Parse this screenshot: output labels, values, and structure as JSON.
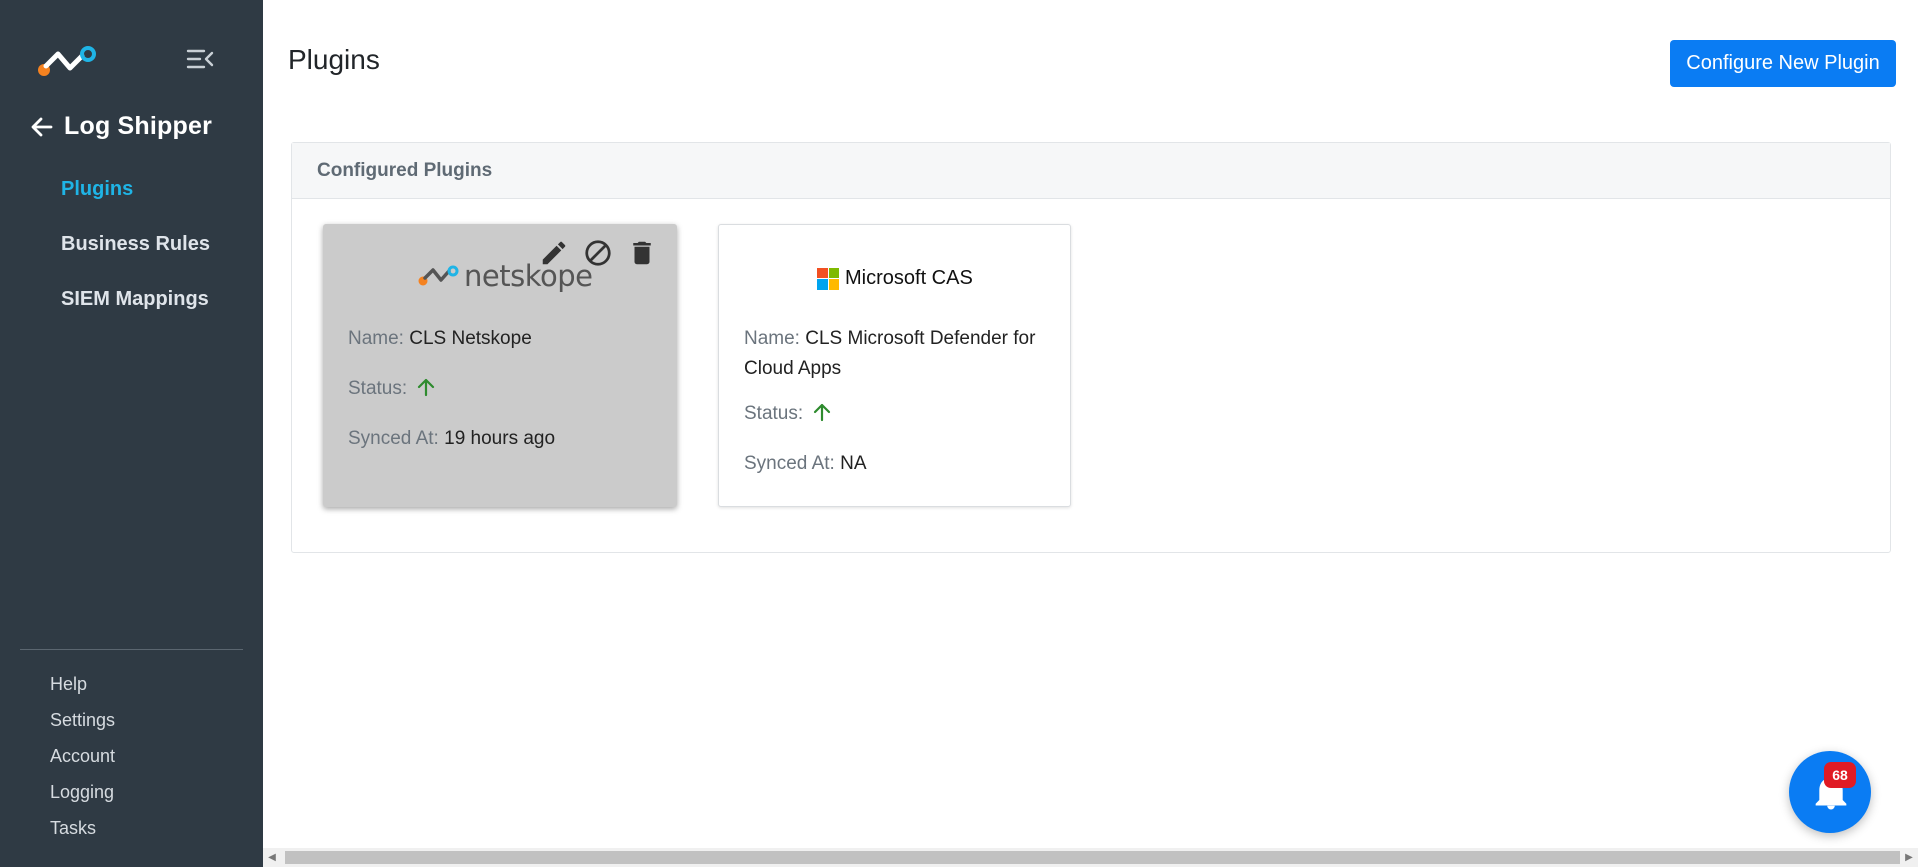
{
  "app": {
    "brand_color": "#0a7cf3",
    "sidebar_bg": "#2f3a44",
    "accent_nav": "#1fb4e6"
  },
  "sidebar": {
    "back_title": "Log Shipper",
    "nav": [
      {
        "label": "Plugins",
        "active": true
      },
      {
        "label": "Business Rules",
        "active": false
      },
      {
        "label": "SIEM Mappings",
        "active": false
      }
    ],
    "bottom": [
      {
        "label": "Help"
      },
      {
        "label": "Settings"
      },
      {
        "label": "Account"
      },
      {
        "label": "Logging"
      },
      {
        "label": "Tasks"
      }
    ]
  },
  "header": {
    "title": "Plugins",
    "primary_button": "Configure New Plugin"
  },
  "panel": {
    "title": "Configured Plugins",
    "cards": [
      {
        "brand": "netskope",
        "name_label": "Name:",
        "name": "CLS Netskope",
        "status_label": "Status:",
        "status_icon": "arrow-up-icon",
        "status_color": "#2e8b2e",
        "synced_label": "Synced At:",
        "synced": "19 hours ago",
        "actions": [
          "edit-icon",
          "disable-icon",
          "delete-icon"
        ]
      },
      {
        "brand": "Microsoft CAS",
        "name_label": "Name:",
        "name_line1": "CLS Microsoft Defender for",
        "name_line2": "Cloud Apps",
        "status_label": "Status:",
        "status_icon": "arrow-up-icon",
        "status_color": "#2e8b2e",
        "synced_label": "Synced At:",
        "synced": "NA"
      }
    ]
  },
  "notifications": {
    "count": "68",
    "icon": "bell-icon"
  }
}
